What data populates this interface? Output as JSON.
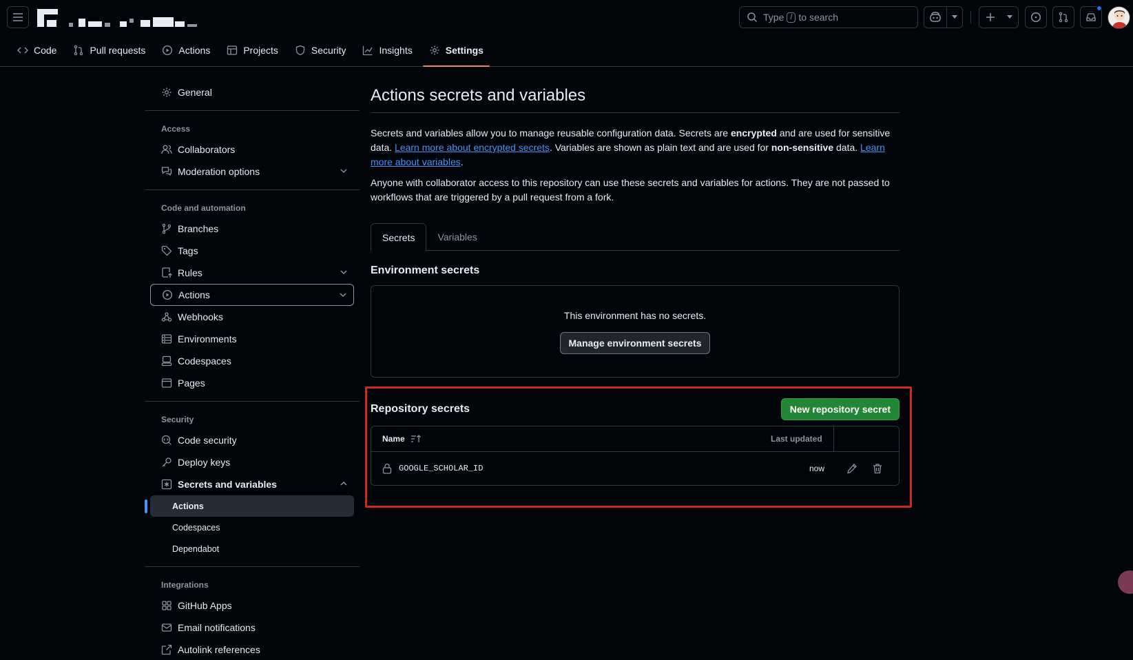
{
  "header": {
    "search_label_before": "Type",
    "search_key": "/",
    "search_label_after": "to search"
  },
  "repo_nav": {
    "tabs": [
      {
        "label": "Code",
        "icon": "code-icon"
      },
      {
        "label": "Pull requests",
        "icon": "git-pull-request-icon"
      },
      {
        "label": "Actions",
        "icon": "play-circle-icon"
      },
      {
        "label": "Projects",
        "icon": "table-icon"
      },
      {
        "label": "Security",
        "icon": "shield-icon"
      },
      {
        "label": "Insights",
        "icon": "graph-icon"
      },
      {
        "label": "Settings",
        "icon": "gear-icon",
        "active": true
      }
    ]
  },
  "sidebar": {
    "general": "General",
    "access_heading": "Access",
    "collaborators": "Collaborators",
    "moderation": "Moderation options",
    "code_heading": "Code and automation",
    "branches": "Branches",
    "tags": "Tags",
    "rules": "Rules",
    "actions": "Actions",
    "webhooks": "Webhooks",
    "environments": "Environments",
    "codespaces": "Codespaces",
    "pages": "Pages",
    "security_heading": "Security",
    "code_security": "Code security",
    "deploy_keys": "Deploy keys",
    "secrets_vars": "Secrets and variables",
    "sub_actions": "Actions",
    "sub_codespaces": "Codespaces",
    "sub_dependabot": "Dependabot",
    "integrations_heading": "Integrations",
    "github_apps": "GitHub Apps",
    "email_notifications": "Email notifications",
    "autolink": "Autolink references"
  },
  "main": {
    "title": "Actions secrets and variables",
    "desc1_a": "Secrets and variables allow you to manage reusable configuration data. Secrets are ",
    "desc1_b": "encrypted",
    "desc1_c": " and are used for sensitive data. ",
    "desc1_link1": "Learn more about encrypted secrets",
    "desc1_d": ". Variables are shown as plain text and are used for ",
    "desc1_e": "non-sensitive",
    "desc1_f": " data. ",
    "desc1_link2": "Learn more about variables",
    "desc1_g": ".",
    "desc2": "Anyone with collaborator access to this repository can use these secrets and variables for actions. They are not passed to workflows that are triggered by a pull request from a fork.",
    "tab_secrets": "Secrets",
    "tab_variables": "Variables",
    "env_title": "Environment secrets",
    "env_empty": "This environment has no secrets.",
    "manage_button": "Manage environment secrets",
    "repo_title": "Repository secrets",
    "new_secret_button": "New repository secret",
    "table": {
      "col_name": "Name",
      "col_updated": "Last updated",
      "rows": [
        {
          "name": "GOOGLE_SCHOLAR_ID",
          "updated": "now"
        }
      ]
    }
  },
  "colors": {
    "background": "#010409",
    "border": "#30363d",
    "accent_underline": "#f78166",
    "link": "#4493f8",
    "primary_button": "#238636",
    "highlight_box": "#cf2a1a"
  }
}
